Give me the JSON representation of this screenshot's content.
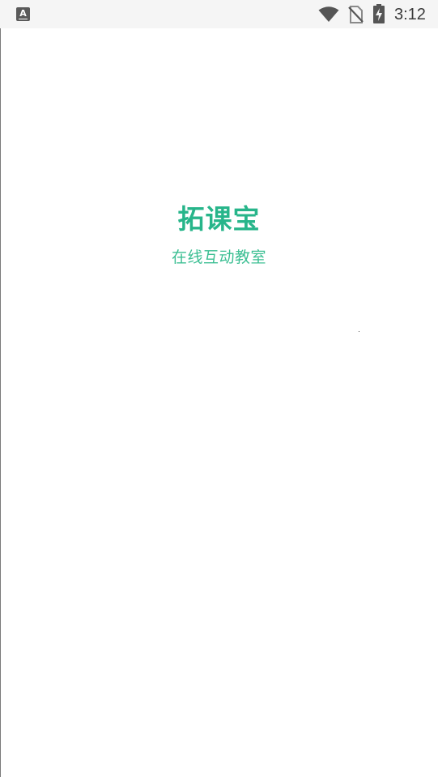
{
  "status_bar": {
    "notification_icon": "font-a-icon",
    "notification_glyph": "A",
    "icons": [
      "wifi-icon",
      "no-sim-icon",
      "battery-charging-icon"
    ],
    "time": "3:12"
  },
  "splash": {
    "title": "拓课宝",
    "subtitle": "在线互动教室"
  },
  "colors": {
    "brand": "#27b58a",
    "background": "#ffffff",
    "status_bar_bg": "#f5f5f5"
  }
}
